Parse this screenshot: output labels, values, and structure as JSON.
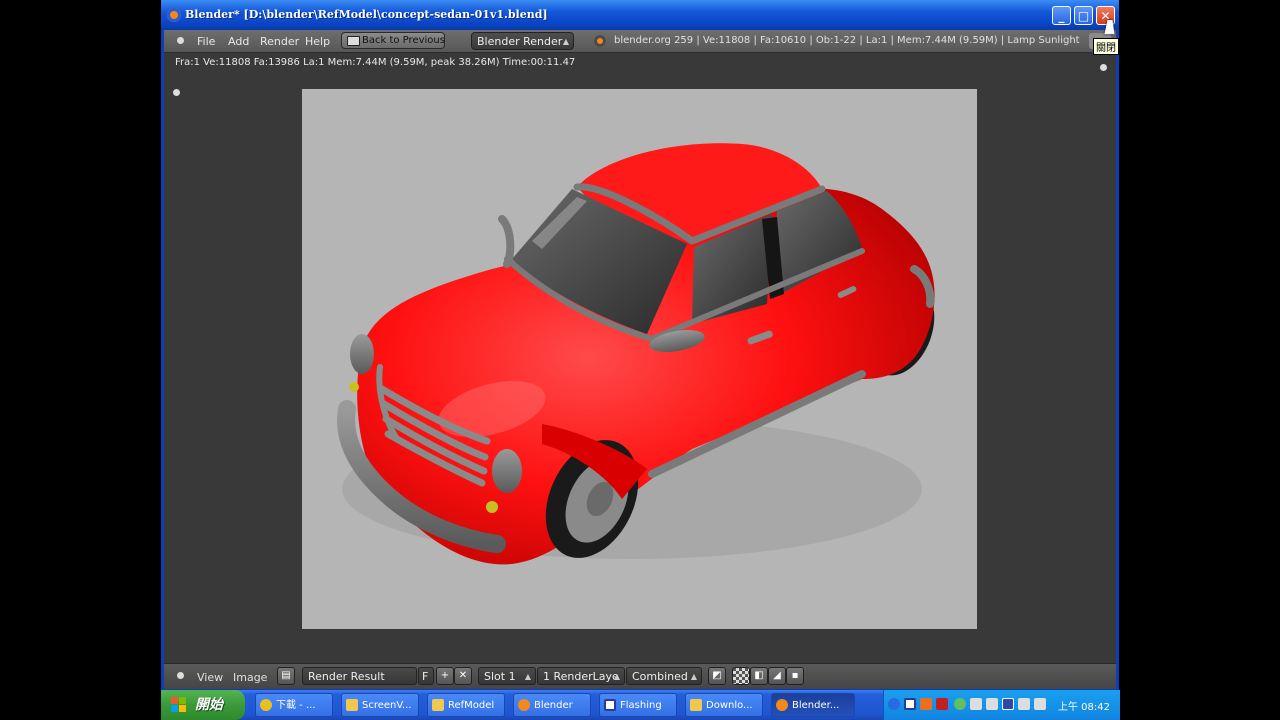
{
  "window": {
    "title": "Blender* [D:\\blender\\RefModel\\concept-sedan-01v1.blend]",
    "tooltip": "關閉",
    "buttons": {
      "minimize": "_",
      "maximize": "□",
      "close": "✕"
    }
  },
  "header": {
    "menu": [
      "File",
      "Add",
      "Render",
      "Help"
    ],
    "back_button": "Back to Previous",
    "engine": "Blender Render",
    "info": "blender.org 259 | Ve:11808 | Fa:10610 | Ob:1-22 | La:1 | Mem:7.44M (9.59M) | Lamp Sunlight"
  },
  "status": "Fra:1  Ve:11808 Fa:13986 La:1 Mem:7.44M (9.59M, peak 38.26M) Time:00:11.47",
  "footer": {
    "view": "View",
    "image": "Image",
    "image_name": "Render Result",
    "fake_user": "F",
    "slot": "Slot 1",
    "render_layer": "1 RenderLaye",
    "pass": "Combined"
  },
  "taskbar": {
    "start": "開始",
    "tasks": [
      {
        "label": "下載 - ...",
        "color": "#e8c020"
      },
      {
        "label": "ScreenV...",
        "color": "#f0c850"
      },
      {
        "label": "RefModel",
        "color": "#f0c850"
      },
      {
        "label": "Blender",
        "color": "#f08a1c"
      },
      {
        "label": "Flashing",
        "color": "#2a3a9a"
      },
      {
        "label": "Downlo...",
        "color": "#f0c850"
      },
      {
        "label": "Blender...",
        "color": "#f08a1c"
      }
    ],
    "clock": "上午 08:42"
  },
  "colors": {
    "car_body": "#ff1010",
    "render_bg": "#b5b5b5",
    "editor_bg": "#393939"
  }
}
